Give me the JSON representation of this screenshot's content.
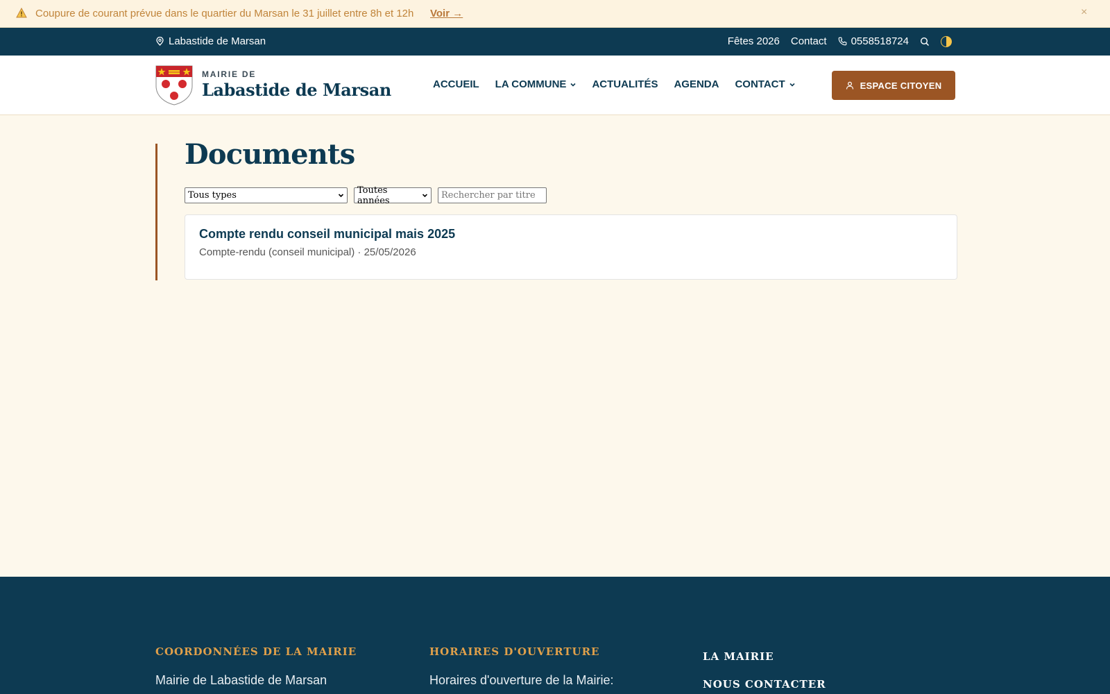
{
  "alert": {
    "message": "Coupure de courant prévue dans le quartier du Marsan le 31 juillet entre 8h et 12h",
    "link": "Voir →",
    "close": "×"
  },
  "topbar": {
    "location": "Labastide de Marsan",
    "links": [
      "Fêtes 2026",
      "Contact"
    ],
    "phone": "0558518724"
  },
  "header": {
    "brand_sub": "MAIRIE DE",
    "brand_title": "Labastide de Marsan",
    "nav": [
      "ACCUEIL",
      "LA COMMUNE",
      "ACTUALITÉS",
      "AGENDA",
      "CONTACT"
    ],
    "cta": "ESPACE CITOYEN"
  },
  "main": {
    "title": "Documents",
    "filters": {
      "type": "Tous types",
      "year": "Toutes années",
      "search_placeholder": "Rechercher par titre"
    },
    "documents": [
      {
        "title": "Compte rendu conseil municipal mais 2025",
        "meta": "Compte-rendu (conseil municipal) · 25/05/2026"
      }
    ]
  },
  "footer": {
    "col1_heading": "COORDONNÉES DE LA MAIRIE",
    "col1_text": "Mairie de Labastide de Marsan",
    "col2_heading": "HORAIRES D'OUVERTURE",
    "col2_text": "Horaires d'ouverture de la Mairie:",
    "links": [
      "LA MAIRIE",
      "NOUS CONTACTER"
    ]
  },
  "colors": {
    "primary": "#0d3a52",
    "accent": "#9b5524",
    "background": "#fdf8ec",
    "footer_heading": "#e0a04a"
  }
}
